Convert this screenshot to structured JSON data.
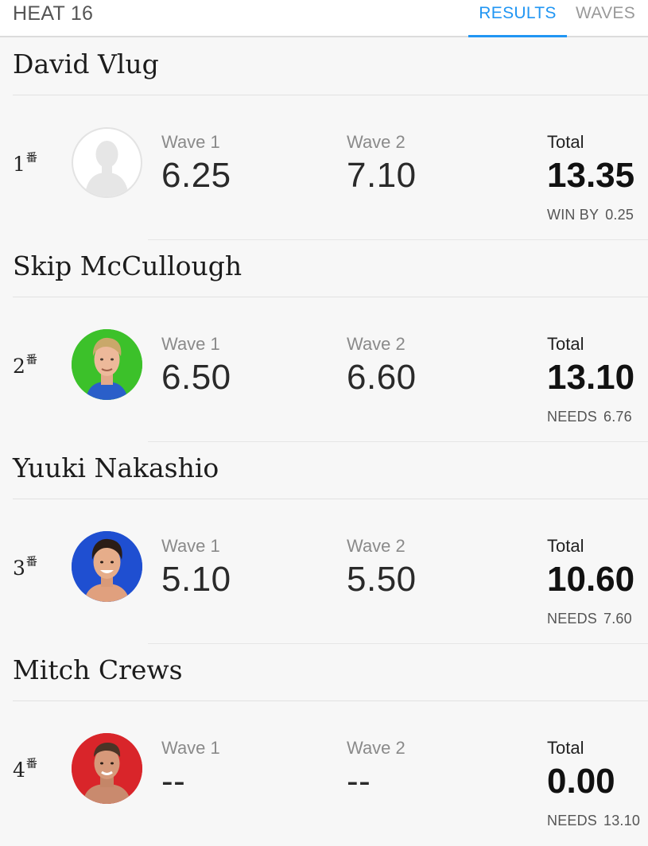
{
  "header": {
    "heat_title": "HEAT 16",
    "tabs": [
      {
        "label": "RESULTS",
        "active": true
      },
      {
        "label": "WAVES",
        "active": false
      }
    ],
    "accent_color": "#2196f3"
  },
  "place_suffix": "番",
  "surfers": [
    {
      "name": "David Vlug",
      "place": "1",
      "avatar": "default-silhouette",
      "avatar_color": "#ffffff",
      "wave1_label": "Wave 1",
      "wave1": "6.25",
      "wave2_label": "Wave 2",
      "wave2": "7.10",
      "total_label": "Total",
      "total": "13.35",
      "status_label": "WIN BY",
      "status_value": "0.25"
    },
    {
      "name": "Skip McCullough",
      "place": "2",
      "avatar": "surfer-photo",
      "avatar_color": "#3cc12a",
      "wave1_label": "Wave 1",
      "wave1": "6.50",
      "wave2_label": "Wave 2",
      "wave2": "6.60",
      "total_label": "Total",
      "total": "13.10",
      "status_label": "NEEDS",
      "status_value": "6.76"
    },
    {
      "name": "Yuuki Nakashio",
      "place": "3",
      "avatar": "surfer-photo",
      "avatar_color": "#1f4fd1",
      "wave1_label": "Wave 1",
      "wave1": "5.10",
      "wave2_label": "Wave 2",
      "wave2": "5.50",
      "total_label": "Total",
      "total": "10.60",
      "status_label": "NEEDS",
      "status_value": "7.60"
    },
    {
      "name": "Mitch Crews",
      "place": "4",
      "avatar": "surfer-photo",
      "avatar_color": "#d9252a",
      "wave1_label": "Wave 1",
      "wave1": "--",
      "wave2_label": "Wave 2",
      "wave2": "--",
      "total_label": "Total",
      "total": "0.00",
      "status_label": "NEEDS",
      "status_value": "13.10"
    }
  ]
}
